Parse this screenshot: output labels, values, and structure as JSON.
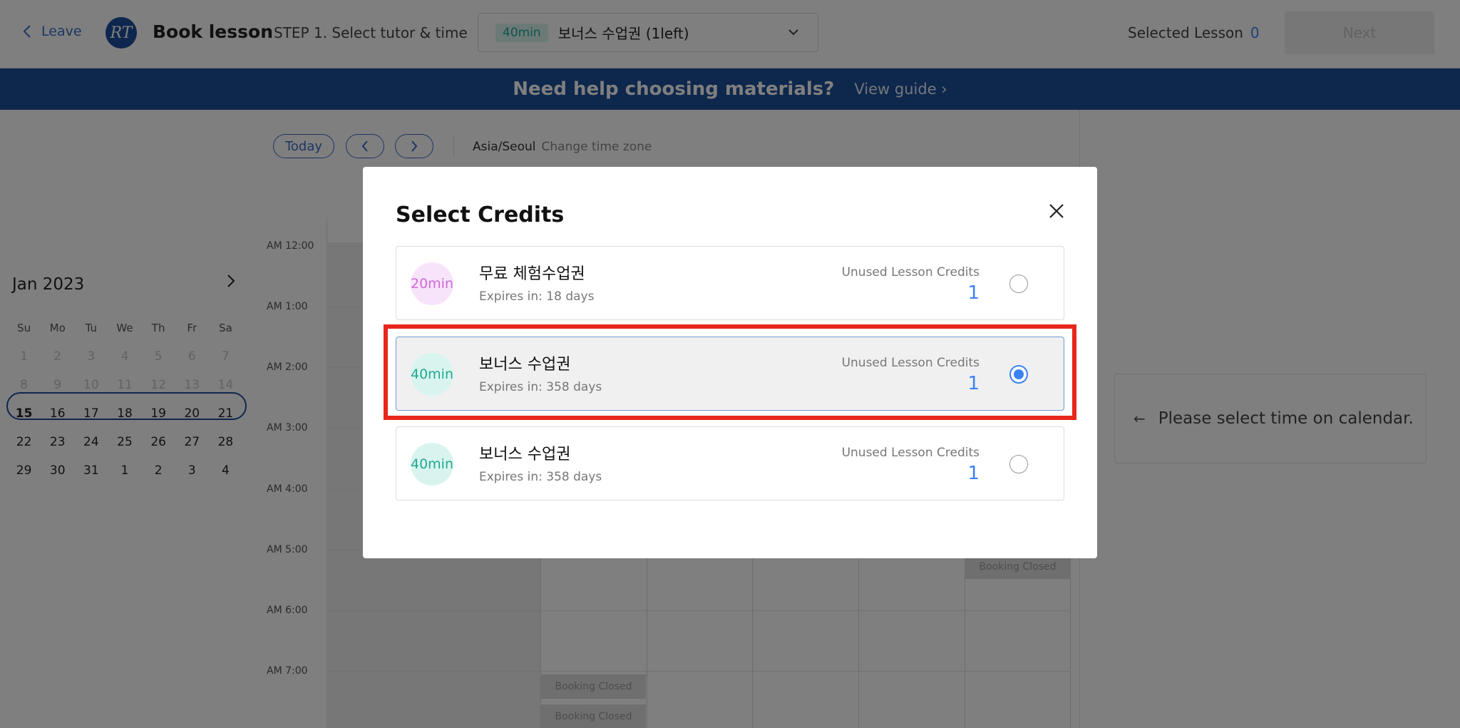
{
  "header": {
    "leave_label": "Leave",
    "logo_text": "RT",
    "title": "Book lesson",
    "step": "STEP 1. Select tutor & time",
    "credit_select": {
      "tag": "40min",
      "value": "보너스 수업권  (1left)"
    },
    "selected_lesson_label": "Selected Lesson",
    "selected_lesson_count": "0",
    "next_label": "Next"
  },
  "banner": {
    "question": "Need help choosing materials?",
    "guide": "View guide"
  },
  "calendar": {
    "today_label": "Today",
    "timezone": "Asia/Seoul",
    "change_timezone": "Change time zone",
    "mini": {
      "month": "Jan 2023",
      "dow": [
        "Su",
        "Mo",
        "Tu",
        "We",
        "Th",
        "Fr",
        "Sa"
      ],
      "weeks": [
        [
          "1",
          "2",
          "3",
          "4",
          "5",
          "6",
          "7"
        ],
        [
          "8",
          "9",
          "10",
          "11",
          "12",
          "13",
          "14"
        ],
        [
          "15",
          "16",
          "17",
          "18",
          "19",
          "20",
          "21"
        ],
        [
          "22",
          "23",
          "24",
          "25",
          "26",
          "27",
          "28"
        ],
        [
          "29",
          "30",
          "31",
          "1",
          "2",
          "3",
          "4"
        ]
      ]
    },
    "times": [
      "AM 12:00",
      "AM 1:00",
      "AM 2:00",
      "AM 3:00",
      "AM 4:00",
      "AM 5:00",
      "AM 6:00",
      "AM 7:00"
    ],
    "booking_closed": "Booking Closed"
  },
  "right_panel": {
    "hint": "Please select time on calendar."
  },
  "modal": {
    "title": "Select Credits",
    "unused_label": "Unused Lesson Credits",
    "credits": [
      {
        "duration": "20min",
        "name": "무료 체험수업권",
        "expires": "Expires in: 18 days",
        "count": "1",
        "selected": false,
        "color": "#cf6ad8"
      },
      {
        "duration": "40min",
        "name": "보너스 수업권",
        "expires": "Expires in: 358 days",
        "count": "1",
        "selected": true,
        "color": "#22a892"
      },
      {
        "duration": "40min",
        "name": "보너스 수업권",
        "expires": "Expires in: 358 days",
        "count": "1",
        "selected": false,
        "color": "#22a892"
      }
    ]
  },
  "colors": {
    "brand": "#1c4f99",
    "accent": "#3b82f6",
    "highlight": "#e8271b"
  }
}
